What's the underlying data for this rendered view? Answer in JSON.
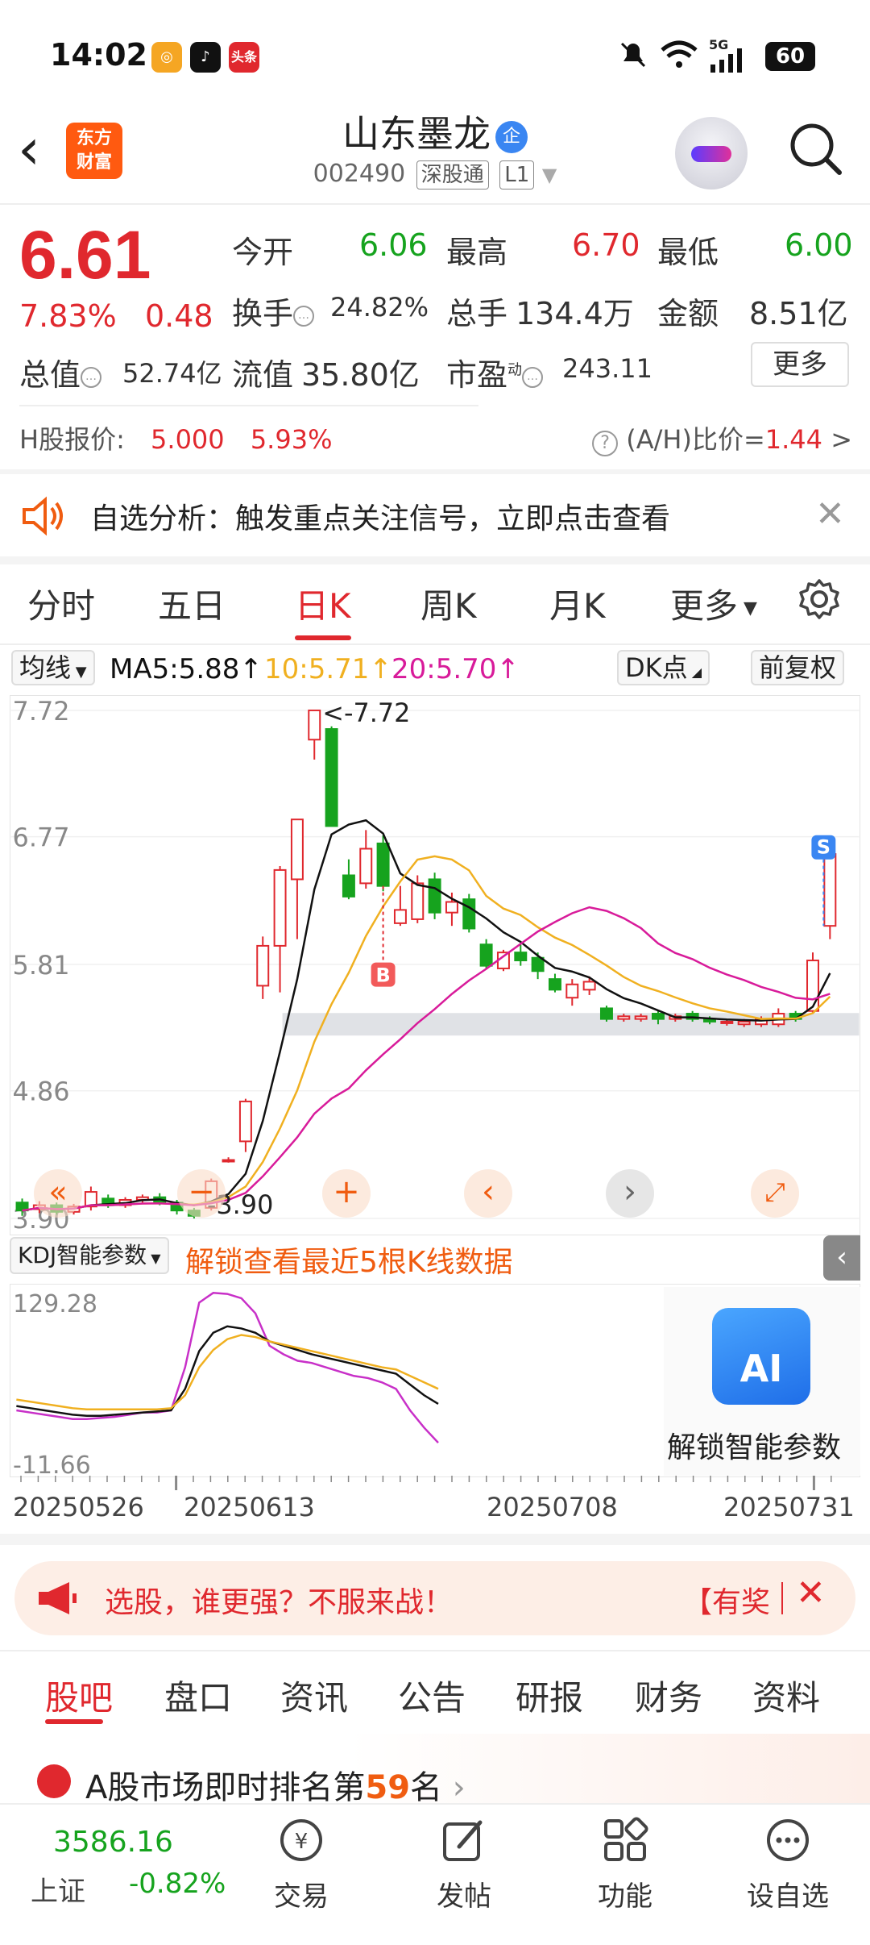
{
  "status_bar": {
    "time": "14:02",
    "battery": "60",
    "signal": "5G"
  },
  "header": {
    "logo_text_1": "东方",
    "logo_text_2": "财富",
    "stock_name": "山东墨龙",
    "badge": "企",
    "code": "002490",
    "tag1": "深股通",
    "tag2": "L1"
  },
  "quote": {
    "price": "6.61",
    "change_pct": "7.83%",
    "change": "0.48",
    "open_label": "今开",
    "open": "6.06",
    "high_label": "最高",
    "high": "6.70",
    "low_label": "最低",
    "low": "6.00",
    "turnover_label": "换手",
    "turnover": "24.82%",
    "volume_label": "总手",
    "volume": "134.4万",
    "amount_label": "金额",
    "amount": "8.51亿",
    "mktcap_label": "总值",
    "mktcap": "52.74亿",
    "float_label": "流值",
    "float": "35.80亿",
    "pe_label": "市盈",
    "pe_sup": "动",
    "pe": "243.11",
    "more": "更多"
  },
  "h_share": {
    "label": "H股报价:",
    "price": "5.000",
    "pct": "5.93%",
    "ah_label": "(A/H)比价=",
    "ah_value": "1.44",
    "arrow": ">"
  },
  "banner": {
    "text": "自选分析：触发重点关注信号，立即点击查看"
  },
  "chart_tabs": [
    "分时",
    "五日",
    "日K",
    "周K",
    "月K",
    "更多"
  ],
  "ma_row": {
    "selector": "均线",
    "ma5": "MA5:5.88",
    "ma10": "10:5.71",
    "ma20": "20:5.70",
    "dk": "DK点",
    "adjust": "前复权"
  },
  "kdj": {
    "label": "KDJ智能参数",
    "unlock": "解锁查看最近5根K线数据",
    "ai_label": "AI",
    "ai_text": "解锁智能参数",
    "ymax": "129.28",
    "ymin": "-11.66"
  },
  "dates": [
    "20250526",
    "20250613",
    "20250708",
    "20250731"
  ],
  "colors": {
    "up": "#e0282e",
    "down": "#16a31e",
    "ma5": "#111111",
    "ma10": "#f0b020",
    "ma20": "#d81b9a",
    "accent": "#ff5a10"
  },
  "chart_data": {
    "type": "candlestick",
    "y_ticks": [
      "7.72",
      "6.77",
      "5.81",
      "4.86",
      "3.90"
    ],
    "ylim": [
      3.9,
      7.72
    ],
    "max_label": "7.72",
    "min_label": "3.90",
    "buy_marker": "B",
    "sell_marker": "S",
    "candles": [
      {
        "o": 4.02,
        "c": 3.96,
        "h": 4.05,
        "l": 3.92
      },
      {
        "o": 3.97,
        "c": 4.0,
        "h": 4.03,
        "l": 3.94
      },
      {
        "o": 4.0,
        "c": 3.95,
        "h": 4.02,
        "l": 3.93
      },
      {
        "o": 3.95,
        "c": 3.99,
        "h": 4.01,
        "l": 3.93
      },
      {
        "o": 3.99,
        "c": 4.1,
        "h": 4.14,
        "l": 3.96
      },
      {
        "o": 4.05,
        "c": 4.0,
        "h": 4.08,
        "l": 3.98
      },
      {
        "o": 4.0,
        "c": 4.04,
        "h": 4.06,
        "l": 3.98
      },
      {
        "o": 4.04,
        "c": 4.06,
        "h": 4.08,
        "l": 4.01
      },
      {
        "o": 4.06,
        "c": 4.02,
        "h": 4.09,
        "l": 4.0
      },
      {
        "o": 4.02,
        "c": 3.96,
        "h": 4.04,
        "l": 3.93
      },
      {
        "o": 3.96,
        "c": 3.92,
        "h": 3.98,
        "l": 3.9
      },
      {
        "o": 3.98,
        "c": 4.18,
        "h": 4.2,
        "l": 3.96
      },
      {
        "o": 4.34,
        "c": 4.34,
        "h": 4.36,
        "l": 4.32
      },
      {
        "o": 4.48,
        "c": 4.78,
        "h": 4.8,
        "l": 4.4
      },
      {
        "o": 5.65,
        "c": 5.95,
        "h": 6.02,
        "l": 5.55
      },
      {
        "o": 5.95,
        "c": 6.52,
        "h": 6.55,
        "l": 5.6
      },
      {
        "o": 6.45,
        "c": 6.9,
        "h": 6.9,
        "l": 6.0
      },
      {
        "o": 7.5,
        "c": 7.72,
        "h": 7.72,
        "l": 7.35
      },
      {
        "o": 7.58,
        "c": 6.85,
        "h": 7.6,
        "l": 6.85
      },
      {
        "o": 6.48,
        "c": 6.32,
        "h": 6.6,
        "l": 6.3
      },
      {
        "o": 6.42,
        "c": 6.68,
        "h": 6.82,
        "l": 6.38
      },
      {
        "o": 6.72,
        "c": 6.4,
        "h": 6.78,
        "l": 6.36
      },
      {
        "o": 6.12,
        "c": 6.22,
        "h": 6.4,
        "l": 6.1
      },
      {
        "o": 6.15,
        "c": 6.42,
        "h": 6.48,
        "l": 6.12
      },
      {
        "o": 6.45,
        "c": 6.2,
        "h": 6.5,
        "l": 6.15
      },
      {
        "o": 6.2,
        "c": 6.28,
        "h": 6.35,
        "l": 6.1
      },
      {
        "o": 6.3,
        "c": 6.08,
        "h": 6.34,
        "l": 6.05
      },
      {
        "o": 5.96,
        "c": 5.8,
        "h": 6.0,
        "l": 5.78
      },
      {
        "o": 5.78,
        "c": 5.9,
        "h": 5.92,
        "l": 5.76
      },
      {
        "o": 5.9,
        "c": 5.84,
        "h": 5.96,
        "l": 5.8
      },
      {
        "o": 5.86,
        "c": 5.76,
        "h": 5.9,
        "l": 5.7
      },
      {
        "o": 5.7,
        "c": 5.62,
        "h": 5.74,
        "l": 5.6
      },
      {
        "o": 5.56,
        "c": 5.66,
        "h": 5.7,
        "l": 5.5
      },
      {
        "o": 5.62,
        "c": 5.68,
        "h": 5.72,
        "l": 5.58
      },
      {
        "o": 5.48,
        "c": 5.4,
        "h": 5.5,
        "l": 5.38
      },
      {
        "o": 5.4,
        "c": 5.42,
        "h": 5.44,
        "l": 5.38
      },
      {
        "o": 5.4,
        "c": 5.42,
        "h": 5.44,
        "l": 5.38
      },
      {
        "o": 5.44,
        "c": 5.4,
        "h": 5.46,
        "l": 5.36
      },
      {
        "o": 5.4,
        "c": 5.42,
        "h": 5.44,
        "l": 5.38
      },
      {
        "o": 5.44,
        "c": 5.4,
        "h": 5.46,
        "l": 5.38
      },
      {
        "o": 5.4,
        "c": 5.38,
        "h": 5.42,
        "l": 5.36
      },
      {
        "o": 5.38,
        "c": 5.38,
        "h": 5.4,
        "l": 5.35
      },
      {
        "o": 5.36,
        "c": 5.38,
        "h": 5.4,
        "l": 5.34
      },
      {
        "o": 5.36,
        "c": 5.4,
        "h": 5.42,
        "l": 5.34
      },
      {
        "o": 5.36,
        "c": 5.44,
        "h": 5.48,
        "l": 5.34
      },
      {
        "o": 5.44,
        "c": 5.4,
        "h": 5.46,
        "l": 5.38
      },
      {
        "o": 5.46,
        "c": 5.84,
        "h": 5.9,
        "l": 5.44
      },
      {
        "o": 6.1,
        "c": 6.64,
        "h": 6.72,
        "l": 6.0
      }
    ]
  }
}
